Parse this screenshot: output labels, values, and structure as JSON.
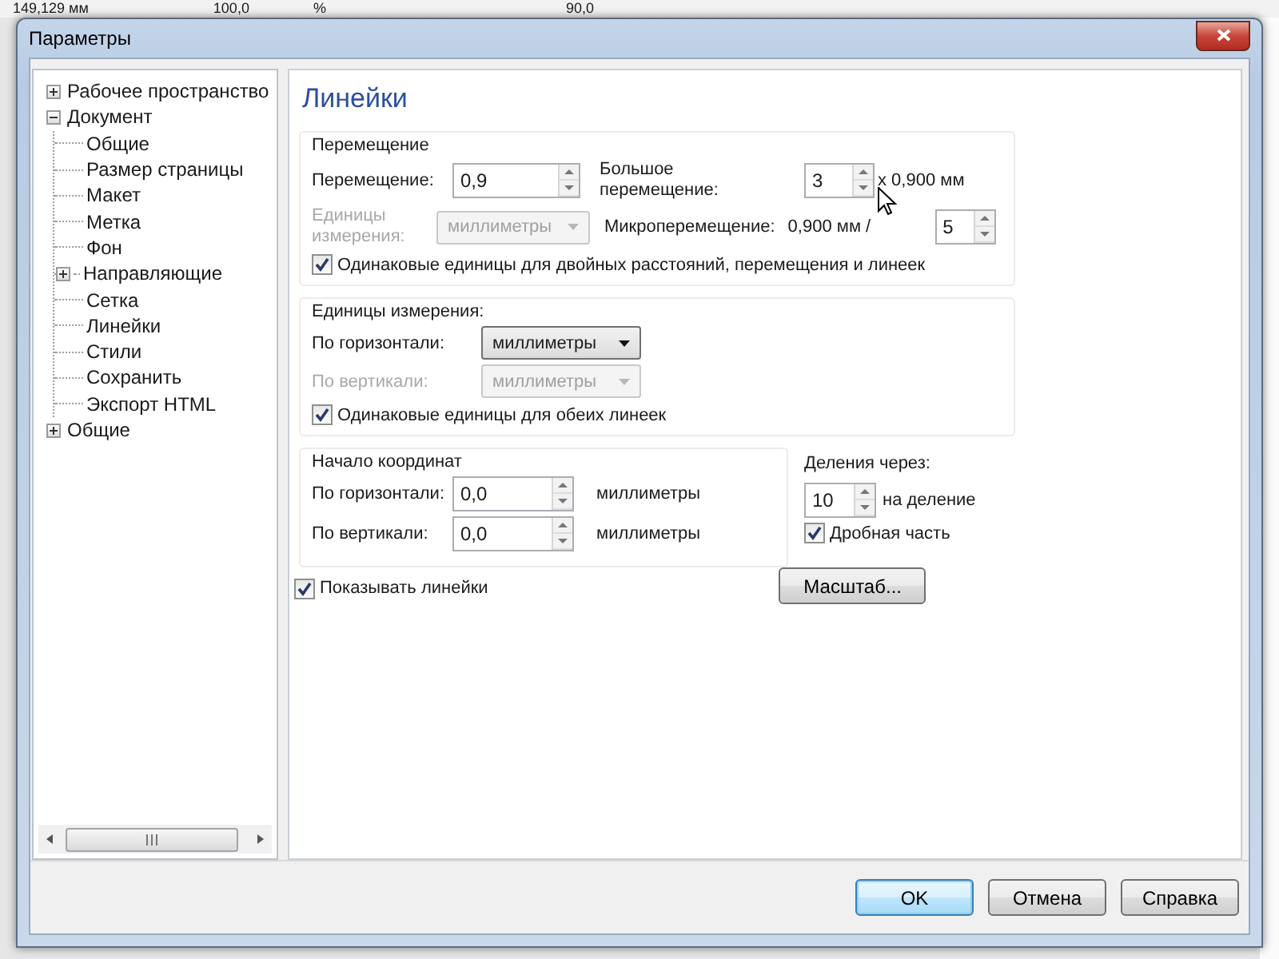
{
  "app_toolbar": {
    "texts": [
      "149,129 мм",
      "100,0",
      "%",
      "90,0"
    ]
  },
  "window": {
    "title": "Параметры"
  },
  "tree": {
    "items": [
      {
        "label": "Рабочее пространство",
        "expanded": false
      },
      {
        "label": "Документ",
        "expanded": true,
        "children": [
          {
            "label": "Общие"
          },
          {
            "label": "Размер страницы"
          },
          {
            "label": "Макет"
          },
          {
            "label": "Метка"
          },
          {
            "label": "Фон"
          },
          {
            "label": "Направляющие",
            "expanded": false
          },
          {
            "label": "Сетка"
          },
          {
            "label": "Линейки"
          },
          {
            "label": "Стили"
          },
          {
            "label": "Сохранить"
          },
          {
            "label": "Экспорт HTML"
          }
        ]
      },
      {
        "label": "Общие",
        "expanded": false
      }
    ]
  },
  "page_title": "Линейки",
  "nudge": {
    "legend": "Перемещение",
    "nudge": {
      "label": "Перемещение:",
      "value": "0,9"
    },
    "units": {
      "label": "Единицы измерения:",
      "value": "миллиметры",
      "disabled": true
    },
    "super_nudge": {
      "label": "Большое перемещение:",
      "value": "3",
      "suffix": "x 0,900 мм"
    },
    "micro_nudge": {
      "label": "Микроперемещение:",
      "prefix": "0,900 мм /",
      "value": "5"
    },
    "same_units": {
      "label": "Одинаковые единицы для двойных расстояний, перемещения и линеек",
      "checked": true
    }
  },
  "units": {
    "legend": "Единицы измерения:",
    "horizontal": {
      "label": "По горизонтали:",
      "value": "миллиметры",
      "disabled": false
    },
    "vertical": {
      "label": "По вертикали:",
      "value": "миллиметры",
      "disabled": true
    },
    "same_units": {
      "label": "Одинаковые единицы для обеих линеек",
      "checked": true
    }
  },
  "origin": {
    "legend": "Начало координат",
    "rows": [
      {
        "label": "По горизонтали:",
        "value": "0,0",
        "unit": "миллиметры"
      },
      {
        "label": "По вертикали:",
        "value": "0,0",
        "unit": "миллиметры"
      }
    ]
  },
  "ticks": {
    "label": "Деления через:",
    "value": "10",
    "suffix": "на деление",
    "fraction": {
      "label": "Дробная часть",
      "checked": true
    }
  },
  "show_rulers": {
    "label": "Показывать линейки",
    "checked": true
  },
  "scale_button": "Масштаб...",
  "buttons": [
    {
      "label": "OK",
      "default": true
    },
    {
      "label": "Отмена",
      "default": false
    },
    {
      "label": "Справка",
      "default": false
    }
  ]
}
